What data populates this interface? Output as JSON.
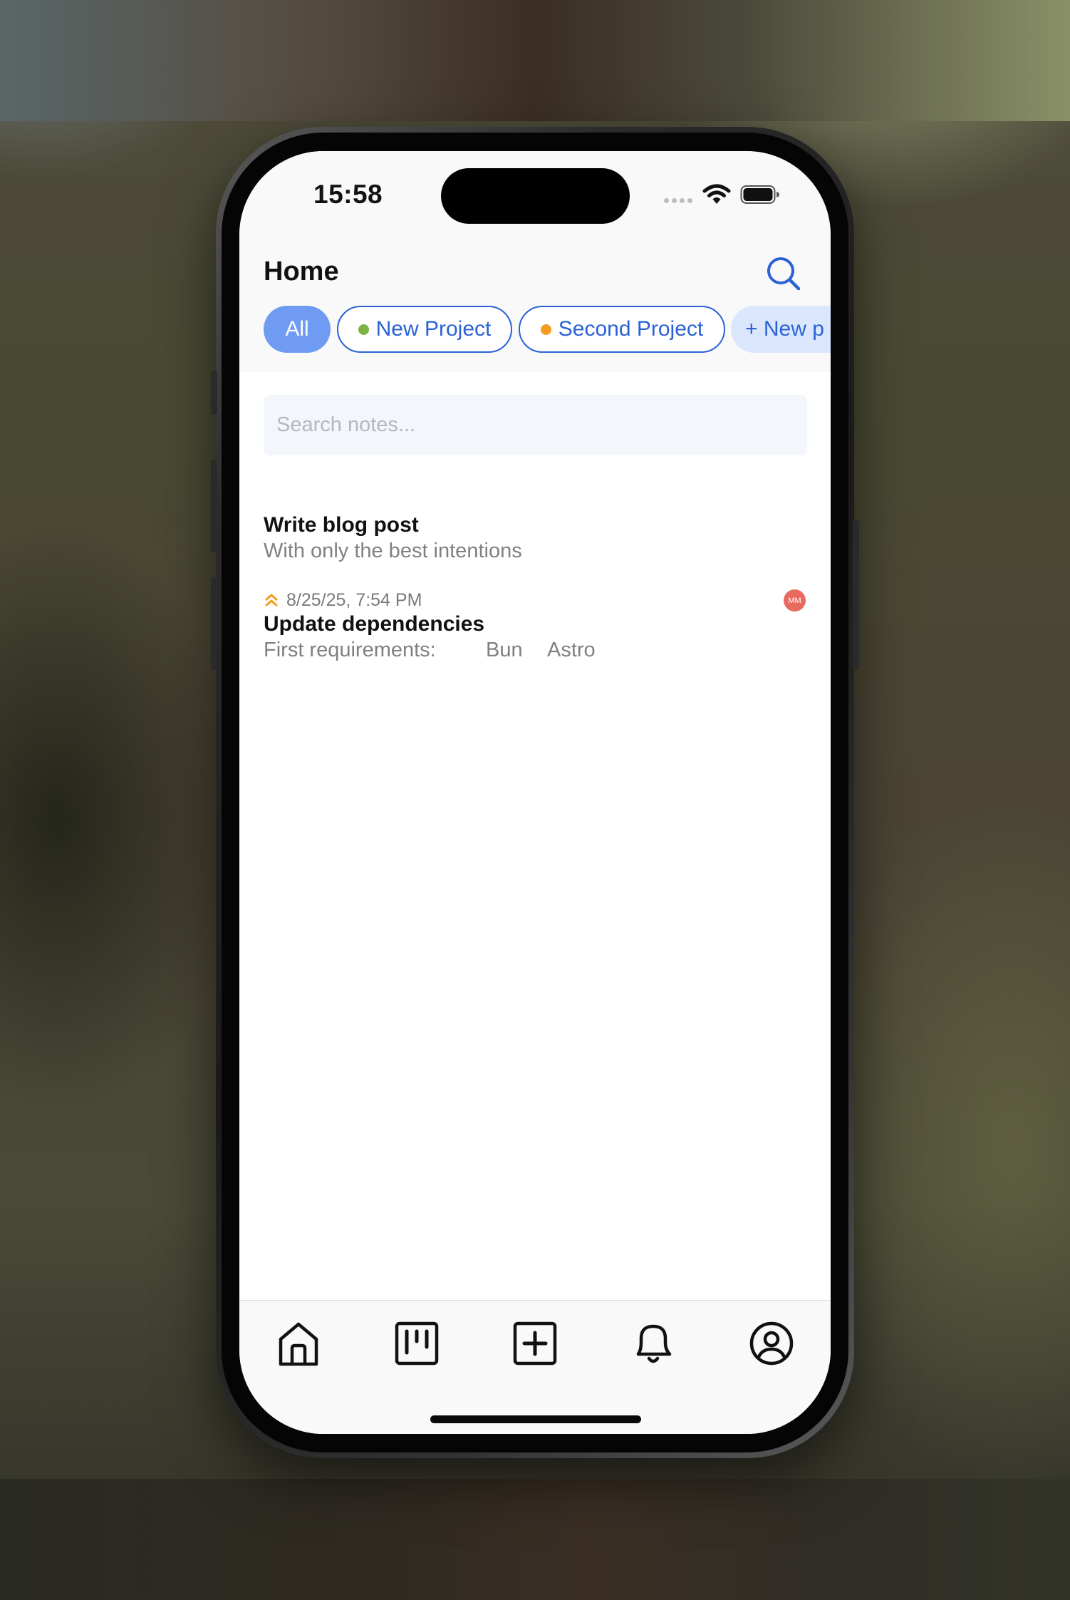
{
  "status_bar": {
    "time": "15:58"
  },
  "header": {
    "title": "Home",
    "search_icon": "search-icon"
  },
  "filters": [
    {
      "label": "All",
      "selected": true
    },
    {
      "label": "New Project",
      "dot_color": "#7cb342"
    },
    {
      "label": "Second Project",
      "dot_color": "#f39c1f"
    },
    {
      "label": "+ New p"
    }
  ],
  "search": {
    "placeholder": "Search notes..."
  },
  "notes": [
    {
      "title": "Write blog post",
      "description": "With only the best intentions"
    },
    {
      "priority_icon": "chevrons-up-icon",
      "date": "8/25/25, 7:54 PM",
      "assignee": "MM",
      "title": "Update dependencies",
      "description": "First requirements:",
      "tags": [
        "Bun",
        "Astro"
      ]
    }
  ],
  "tab_bar": {
    "items": [
      {
        "icon": "home-icon"
      },
      {
        "icon": "kanban-board-icon"
      },
      {
        "icon": "add-square-icon"
      },
      {
        "icon": "bell-icon"
      },
      {
        "icon": "user-circle-icon"
      }
    ]
  },
  "colors": {
    "accent": "#2a62d6",
    "chip_selected": "#6f9bf3",
    "chip_new_bg": "#dbe7fc",
    "priority": "#f39c1f",
    "avatar": "#e86a5f"
  }
}
